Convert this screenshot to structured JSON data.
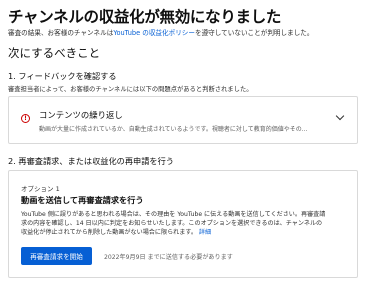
{
  "header": {
    "title": "チャンネルの収益化が無効になりました",
    "intro_prefix": "審査の結果、お客様のチャンネルは",
    "intro_link": "YouTube の収益化ポリシー",
    "intro_suffix": "を遵守していないことが判明しました。"
  },
  "next_steps": {
    "heading": "次にするべきこと",
    "step1": {
      "label": "1. フィードバックを確認する",
      "description": "審査担当者によって、お客様のチャンネルには以下の問題点があると判断されました。",
      "issue": {
        "icon": "warning-icon",
        "title": "コンテンツの繰り返し",
        "description": "動画が大量に作成されているか、自動生成されているようです。視聴者に対して教育的価値やその..."
      }
    },
    "step2": {
      "label": "2. 再審査請求、または収益化の再申請を行う",
      "option": {
        "label": "オプション 1",
        "title": "動画を送信して再審査請求を行う",
        "line1": "YouTube 側に誤りがあると思われる場合は、その理由を YouTube に伝える動画を送信してください。再審査請",
        "line2": "求の内容を確認し、14 日以内に判定をお知らせいたします。このオプションを選択できるのは、チャンネルの",
        "line3": "収益化が停止されてから削除した動画がない場合に限られます。",
        "more_link": "詳細",
        "button": "再審査請求を開始",
        "deadline": "2022年9月9日 までに送信する必要があります"
      }
    }
  },
  "colors": {
    "accent": "#065fd4",
    "warning": "#cc0000"
  }
}
